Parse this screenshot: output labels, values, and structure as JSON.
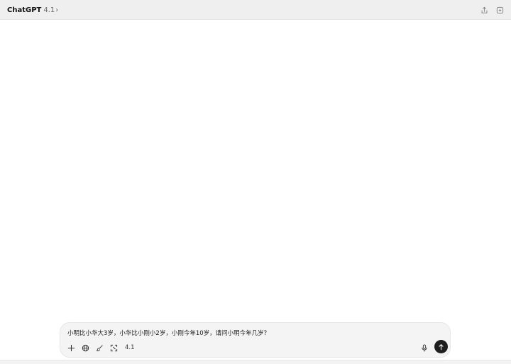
{
  "header": {
    "app_name": "ChatGPT",
    "model_version": "4.1",
    "chevron": "›",
    "icons": [
      "share-icon",
      "new-chat-icon"
    ]
  },
  "composer": {
    "prompt": "小明比小华大3岁，小华比小刚小2岁，小刚今年10岁，请问小明今年几岁？",
    "tools": [
      "plus-icon",
      "globe-icon",
      "paintbrush-icon",
      "screenshot-icon"
    ],
    "model_label": "4.1",
    "mic_icon": "microphone-icon",
    "send_icon": "send-icon"
  },
  "colors": {
    "titlebar": "#efefef",
    "composer_bg": "#f4f4f4",
    "send_button": "#1f1f1f"
  }
}
